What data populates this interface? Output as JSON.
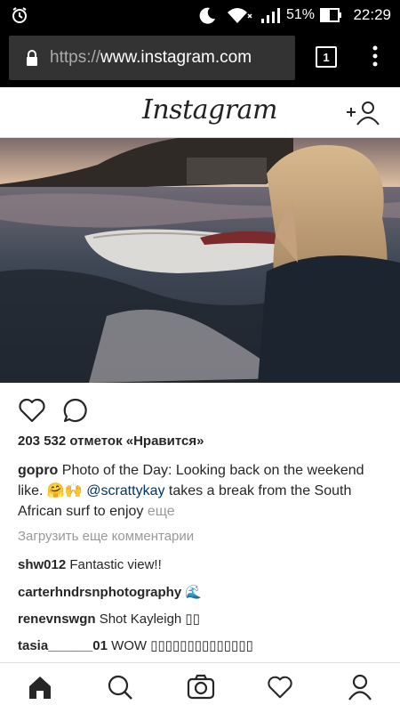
{
  "status_bar": {
    "battery_percent": "51%",
    "time": "22:29",
    "icons": [
      "alarm-icon",
      "moon-icon",
      "wifi-icon",
      "signal-icon",
      "battery-icon"
    ]
  },
  "browser": {
    "url_scheme": "https://",
    "url_host": "www.instagram.com",
    "tab_count": "1"
  },
  "header": {
    "logo_text": "Instagram"
  },
  "post": {
    "likes": "203 532 отметок «Нравится»",
    "caption": {
      "username": "gopro",
      "text_1": "Photo of the Day: Looking back on the weekend like. ",
      "emoji": "🤗🙌",
      "mention": "@scrattykay",
      "text_2": " takes a break from the South African surf to enjoy ",
      "more": "еще"
    },
    "load_more": "Загрузить еще комментарии",
    "comments": [
      {
        "username": "shw012",
        "text": "Fantastic view!!"
      },
      {
        "username": "carterhndrsnphotography",
        "text": "🌊"
      },
      {
        "username": "renevnswgn",
        "text": "Shot Kayleigh ▯▯"
      },
      {
        "username": "tasia______01",
        "text": "WOW ▯▯▯▯▯▯▯▯▯▯▯▯▯▯"
      }
    ]
  },
  "colors": {
    "link": "#003569",
    "muted": "#999999"
  }
}
